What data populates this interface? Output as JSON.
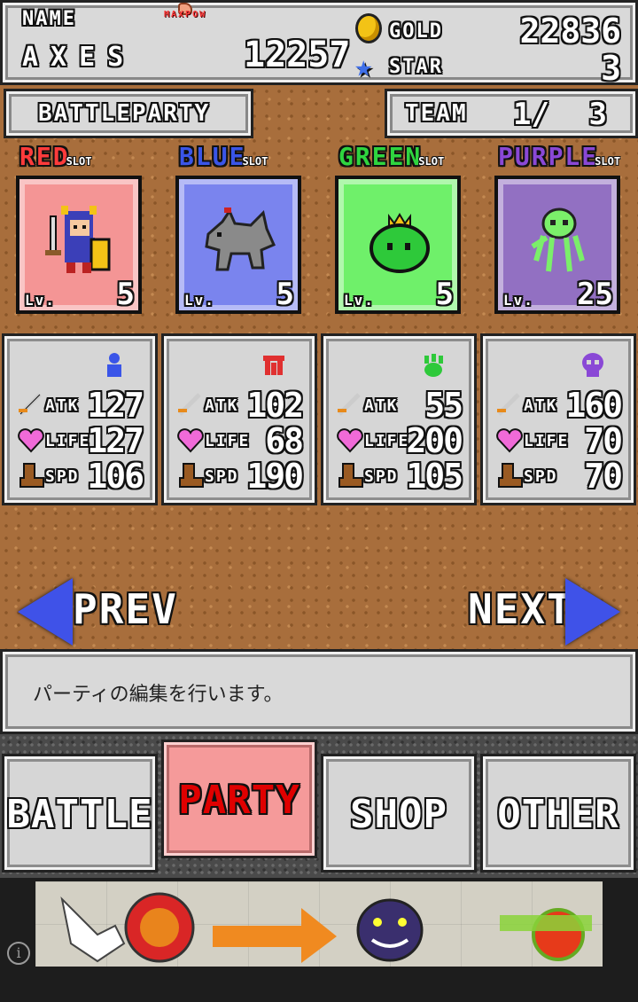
{
  "header": {
    "name_label": "NAME",
    "name_value": "AXES",
    "maxpow_label": "MAXPOW",
    "power_value": "12257",
    "gold_label": "GOLD",
    "gold_value": "22836",
    "star_label": "STAR",
    "star_value": "3"
  },
  "party_label": "BATTLEPARTY",
  "team": {
    "label": "TEAM",
    "current": "1/",
    "total": "3"
  },
  "slots": [
    {
      "title": "RED",
      "sub": "SLOT",
      "title_color": "#ff3b3b",
      "card_bg": "#f49595",
      "lv_label": "Lv.",
      "level": "5",
      "monster": "knight-icon",
      "stats": {
        "atk_label": "ATK",
        "atk": "127",
        "life_label": "LIFE",
        "life": "127",
        "spd_label": "SPD",
        "spd": "106"
      },
      "element_icon": "person-icon"
    },
    {
      "title": "BLUE",
      "sub": "SLOT",
      "title_color": "#3a55e8",
      "card_bg": "#7a84ee",
      "lv_label": "Lv.",
      "level": "5",
      "monster": "wolf-icon",
      "stats": {
        "atk_label": "ATK",
        "atk": "102",
        "life_label": "LIFE",
        "life": "68",
        "spd_label": "SPD",
        "spd": "190"
      },
      "element_icon": "crab-icon"
    },
    {
      "title": "GREEN",
      "sub": "SLOT",
      "title_color": "#2fd53f",
      "card_bg": "#6ff06a",
      "lv_label": "Lv.",
      "level": "5",
      "monster": "slime-icon",
      "stats": {
        "atk_label": "ATK",
        "atk": "55",
        "life_label": "LIFE",
        "life": "200",
        "spd_label": "SPD",
        "spd": "105"
      },
      "element_icon": "paw-icon"
    },
    {
      "title": "PURPLE",
      "sub": "SLOT",
      "title_color": "#8a48d6",
      "card_bg": "#9270c2",
      "lv_label": "Lv.",
      "level": "25",
      "monster": "squid-icon",
      "stats": {
        "atk_label": "ATK",
        "atk": "160",
        "life_label": "LIFE",
        "life": "70",
        "spd_label": "SPD",
        "spd": "70"
      },
      "element_icon": "skull-icon"
    }
  ],
  "nav": {
    "prev": "PREV",
    "next": "NEXT"
  },
  "message": "パーティの編集を行います。",
  "tabs": [
    {
      "label": "BATTLE",
      "active": false
    },
    {
      "label": "PARTY",
      "active": true
    },
    {
      "label": "SHOP",
      "active": false
    },
    {
      "label": "OTHER",
      "active": false
    }
  ],
  "ad": {
    "info_icon": "i"
  },
  "colors": {
    "dirt": "#a86e3c",
    "panel": "#d9d9d9",
    "active_tab": "#f59a9a",
    "arrow": "#3f52e8"
  }
}
